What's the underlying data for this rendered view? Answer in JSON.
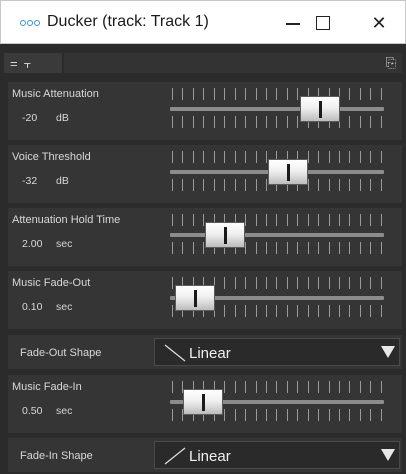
{
  "window": {
    "title": "Ducker (track: Track 1)",
    "app_icon": "ooo-logo-icon",
    "minimize_glyph": "—",
    "maximize_glyph": "☐",
    "close_glyph": "✕"
  },
  "toolbar": {
    "menu_icon": "=",
    "pin_icon": "⫟",
    "preset_icon": "⎘"
  },
  "params": [
    {
      "label": "Music Attenuation",
      "value": "-20",
      "unit": "dB",
      "fraction": 0.73
    },
    {
      "label": "Voice Threshold",
      "value": "-32",
      "unit": "dB",
      "fraction": 0.56
    },
    {
      "label": "Attenuation Hold Time",
      "value": "2.00",
      "unit": "sec",
      "fraction": 0.22
    },
    {
      "label": "Music Fade-Out",
      "value": "0.10",
      "unit": "sec",
      "fraction": 0.06
    },
    {
      "label": "Music Fade-In",
      "value": "0.50",
      "unit": "sec",
      "fraction": 0.1
    }
  ],
  "fade_out_shape": {
    "label": "Fade-Out Shape",
    "value": "Linear",
    "shape": "falling"
  },
  "fade_in_shape": {
    "label": "Fade-In Shape",
    "value": "Linear",
    "shape": "rising"
  },
  "colors": {
    "accent": "#3b8fd6",
    "background": "#2b2b2b",
    "panel": "#353535"
  }
}
